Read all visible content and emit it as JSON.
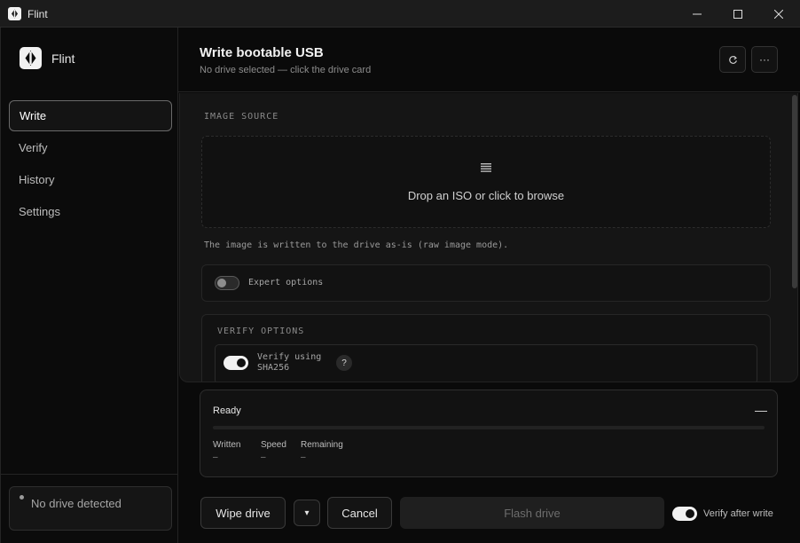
{
  "window": {
    "title": "Flint",
    "controls": [
      "minimize-icon",
      "maximize-icon",
      "close-icon"
    ]
  },
  "sidebar": {
    "brand": "Flint",
    "items": [
      {
        "label": "Write",
        "active": true
      },
      {
        "label": "Verify",
        "active": false
      },
      {
        "label": "History",
        "active": false
      },
      {
        "label": "Settings",
        "active": false
      }
    ],
    "drive_status": "No drive detected"
  },
  "header": {
    "title": "Write bootable USB",
    "subtitle": "No drive selected — click the drive card",
    "refresh_icon": "refresh-icon",
    "more_label": "···"
  },
  "image_source": {
    "label": "IMAGE SOURCE",
    "drop_icon": "list-icon",
    "drop_text": "Drop an ISO or click to browse",
    "note": "The image is written to the drive as-is (raw image mode)."
  },
  "expert_options": {
    "label": "Expert options",
    "enabled": false
  },
  "verify_options": {
    "label": "VERIFY OPTIONS",
    "sha_label_line1": "Verify using",
    "sha_label_line2": "SHA256",
    "sha_enabled": true,
    "help": "?"
  },
  "status": {
    "title": "Ready",
    "collapse": "—",
    "progress": 0,
    "stats": [
      {
        "label": "Written",
        "value": "–"
      },
      {
        "label": "Speed",
        "value": "–"
      },
      {
        "label": "Remaining",
        "value": "–"
      }
    ]
  },
  "footer": {
    "wipe_label": "Wipe drive",
    "dropdown_icon": "▾",
    "cancel_label": "Cancel",
    "flash_label": "Flash drive",
    "verify_after_label": "Verify after write",
    "verify_after_enabled": true
  },
  "colors": {
    "accent": "#f2f2f2",
    "background": "#0a0a0a",
    "panel": "#151515"
  }
}
